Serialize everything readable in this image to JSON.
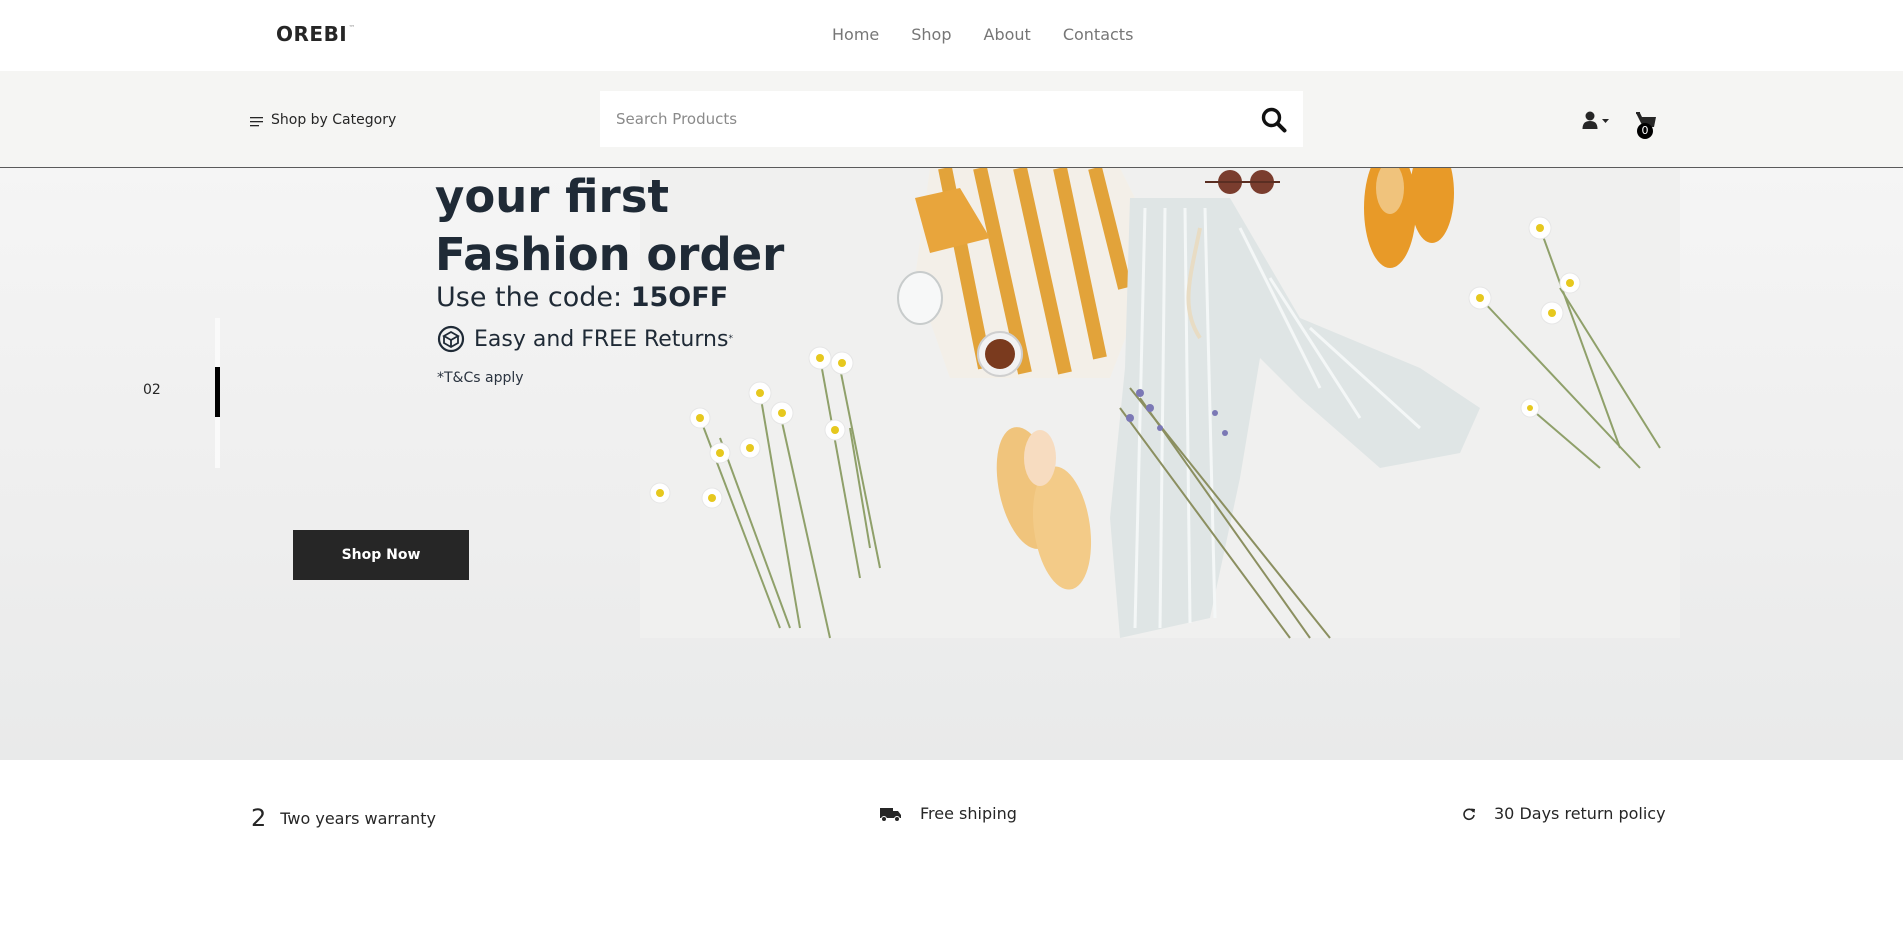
{
  "header": {
    "logo": "OREBI",
    "logo_mark": "™",
    "nav": [
      "Home",
      "Shop",
      "About",
      "Contacts"
    ]
  },
  "toolbar": {
    "category_label": "Shop by Category",
    "search_placeholder": "Search Products",
    "cart_count": "0"
  },
  "hero": {
    "headline_line1": "your first",
    "headline_line2": "Fashion order",
    "code_prefix": "Use the code: ",
    "code": "15OFF",
    "returns_text": "Easy and FREE Returns",
    "returns_mark": "*",
    "terms": "*T&Cs apply",
    "slide_number": "02",
    "cta": "Shop Now"
  },
  "features": [
    {
      "icon_text": "2",
      "label": "Two years warranty"
    },
    {
      "icon": "truck-icon",
      "label": "Free shiping"
    },
    {
      "icon": "refresh-icon",
      "label": "30 Days return policy"
    }
  ]
}
